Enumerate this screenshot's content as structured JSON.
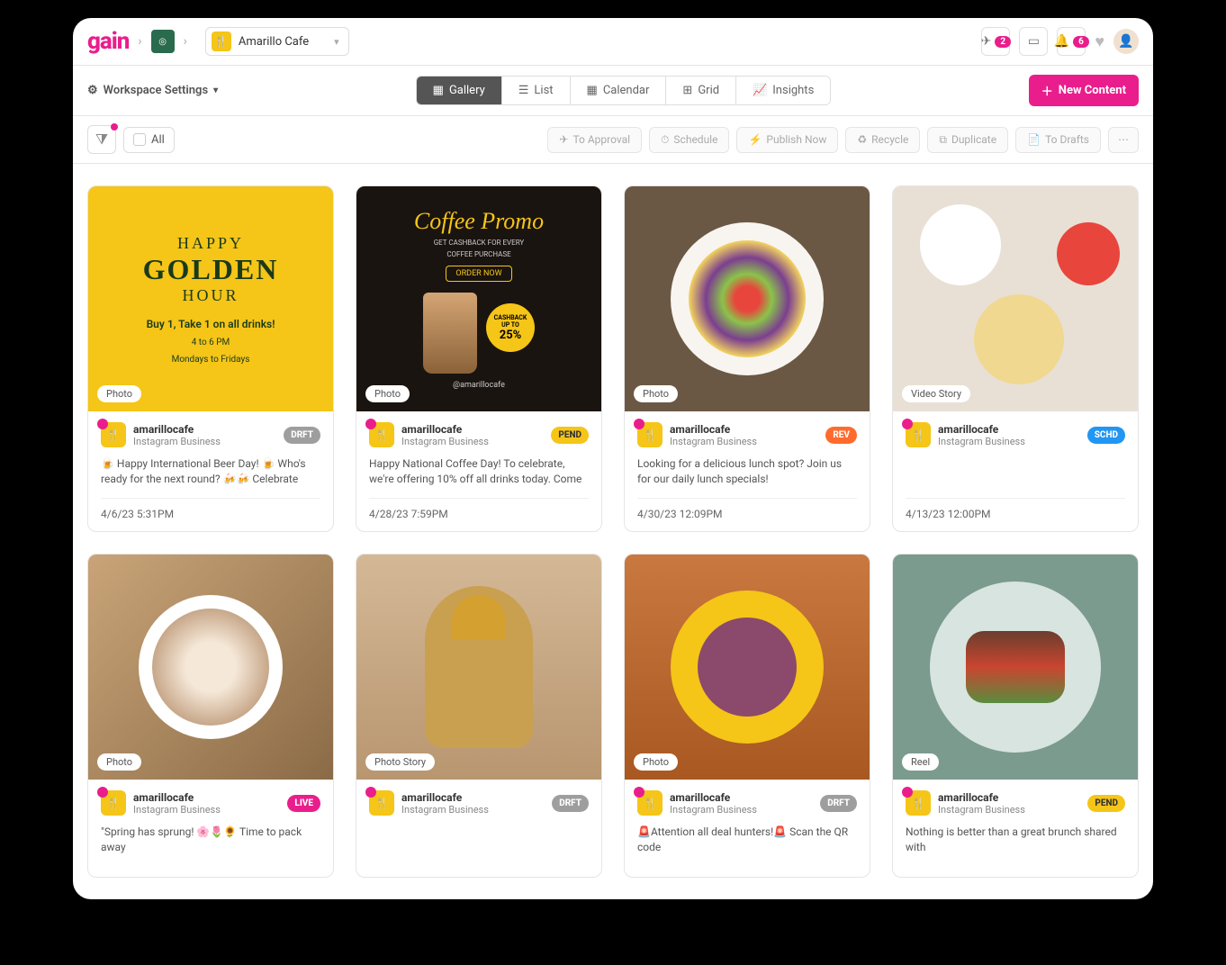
{
  "brand": "gain",
  "workspace": {
    "name": "Amarillo Cafe"
  },
  "topbar": {
    "send_count": "2",
    "notif_count": "6"
  },
  "subbar": {
    "settings": "Workspace Settings",
    "views": [
      {
        "label": "Gallery",
        "icon": "grid-icon",
        "active": true
      },
      {
        "label": "List",
        "icon": "list-icon",
        "active": false
      },
      {
        "label": "Calendar",
        "icon": "calendar-icon",
        "active": false
      },
      {
        "label": "Grid",
        "icon": "grid-alt-icon",
        "active": false
      },
      {
        "label": "Insights",
        "icon": "chart-icon",
        "active": false
      }
    ],
    "new_content": "New Content"
  },
  "actionbar": {
    "all": "All",
    "actions": [
      {
        "label": "To Approval",
        "icon": "✈"
      },
      {
        "label": "Schedule",
        "icon": "⏱"
      },
      {
        "label": "Publish Now",
        "icon": "⚡"
      },
      {
        "label": "Recycle",
        "icon": "♻"
      },
      {
        "label": "Duplicate",
        "icon": "⧉"
      },
      {
        "label": "To Drafts",
        "icon": "📄"
      }
    ]
  },
  "account": {
    "name": "amarillocafe",
    "type": "Instagram Business"
  },
  "cards": [
    {
      "media": "Photo",
      "status": "DRFT",
      "caption": "🍺 Happy International Beer Day! 🍺 Who's ready for the next round? 🍻🍻 Celebrate with us and…",
      "time": "4/6/23 5:31PM",
      "img": {
        "style": "img1",
        "h1": "HAPPY",
        "h2": "GOLDEN",
        "h3": "HOUR",
        "p1": "Buy 1, Take 1 on all drinks!",
        "p2a": "4 to 6 PM",
        "p2b": "Mondays to Fridays"
      }
    },
    {
      "media": "Photo",
      "status": "PEND",
      "caption": "Happy National Coffee Day! To celebrate, we're offering 10% off all drinks today. Come and rais…",
      "time": "4/28/23 7:59PM",
      "img": {
        "style": "img2",
        "t1": "Coffee Promo",
        "t2a": "GET CASHBACK FOR EVERY",
        "t2b": "COFFEE PURCHASE",
        "btn": "ORDER NOW",
        "cb1": "CASHBACK",
        "cb2": "UP TO",
        "cb3": "25%",
        "handle": "@amarillocafe"
      }
    },
    {
      "media": "Photo",
      "status": "REV",
      "caption": "Looking for a delicious lunch spot? Join us for our daily lunch specials!",
      "time": "4/30/23 12:09PM",
      "img": {
        "style": "img3"
      }
    },
    {
      "media": "Video Story",
      "status": "SCHD",
      "caption": "",
      "time": "4/13/23 12:00PM",
      "img": {
        "style": "img4"
      }
    },
    {
      "media": "Photo",
      "status": "LIVE",
      "caption": "\"Spring has sprung! 🌸🌷🌻 Time to pack away",
      "time": "",
      "img": {
        "style": "img5"
      }
    },
    {
      "media": "Photo Story",
      "status": "DRFT",
      "caption": "",
      "time": "",
      "img": {
        "style": "img6"
      }
    },
    {
      "media": "Photo",
      "status": "DRFT",
      "caption": "🚨Attention all deal hunters!🚨 Scan the QR code",
      "time": "",
      "img": {
        "style": "img7"
      }
    },
    {
      "media": "Reel",
      "status": "PEND",
      "caption": "Nothing is better than a great brunch shared with",
      "time": "",
      "img": {
        "style": "img8"
      }
    }
  ]
}
